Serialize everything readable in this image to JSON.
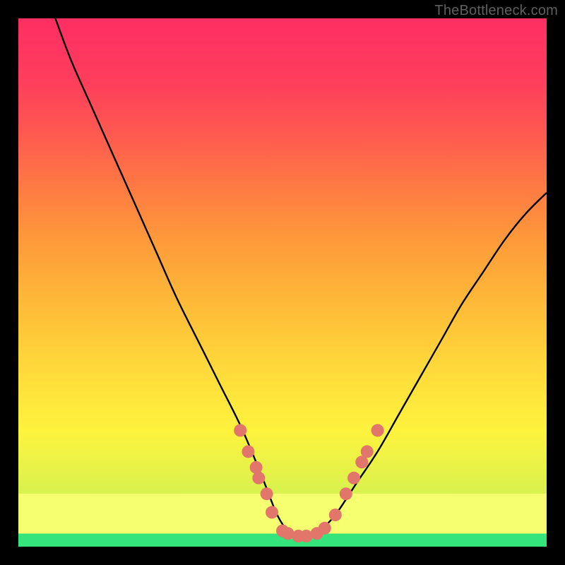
{
  "watermark": "TheBottleneck.com",
  "colors": {
    "curve_stroke": "#000000",
    "dot_fill": "#e2766a",
    "dot_stroke": "#c85a4e"
  },
  "chart_data": {
    "type": "line",
    "title": "",
    "xlabel": "",
    "ylabel": "",
    "xlim": [
      0,
      100
    ],
    "ylim": [
      0,
      100
    ],
    "series": [
      {
        "name": "bottleneck-curve",
        "x": [
          7,
          10,
          14,
          18,
          22,
          26,
          30,
          34,
          38,
          42,
          45,
          47,
          49,
          51,
          53,
          55,
          57,
          60,
          64,
          68,
          72,
          76,
          80,
          84,
          88,
          92,
          96,
          100
        ],
        "y": [
          100,
          92,
          83,
          74,
          65,
          56,
          47,
          39,
          31,
          23,
          16,
          11,
          6,
          3,
          2,
          2,
          3,
          6,
          12,
          18,
          25,
          32,
          39,
          46,
          52,
          58,
          63,
          67
        ]
      }
    ],
    "annotations": {
      "dots": [
        {
          "x": 42,
          "y": 22
        },
        {
          "x": 43.5,
          "y": 18
        },
        {
          "x": 45,
          "y": 15
        },
        {
          "x": 45.5,
          "y": 13
        },
        {
          "x": 47,
          "y": 10
        },
        {
          "x": 48,
          "y": 6.5
        },
        {
          "x": 50,
          "y": 3
        },
        {
          "x": 51,
          "y": 2.5
        },
        {
          "x": 53,
          "y": 2
        },
        {
          "x": 54.5,
          "y": 2
        },
        {
          "x": 56.5,
          "y": 2.5
        },
        {
          "x": 58,
          "y": 3.5
        },
        {
          "x": 60,
          "y": 6
        },
        {
          "x": 62,
          "y": 10
        },
        {
          "x": 63.5,
          "y": 13
        },
        {
          "x": 65,
          "y": 16
        },
        {
          "x": 66,
          "y": 18
        },
        {
          "x": 68,
          "y": 22
        }
      ],
      "dot_radius": 9
    }
  }
}
